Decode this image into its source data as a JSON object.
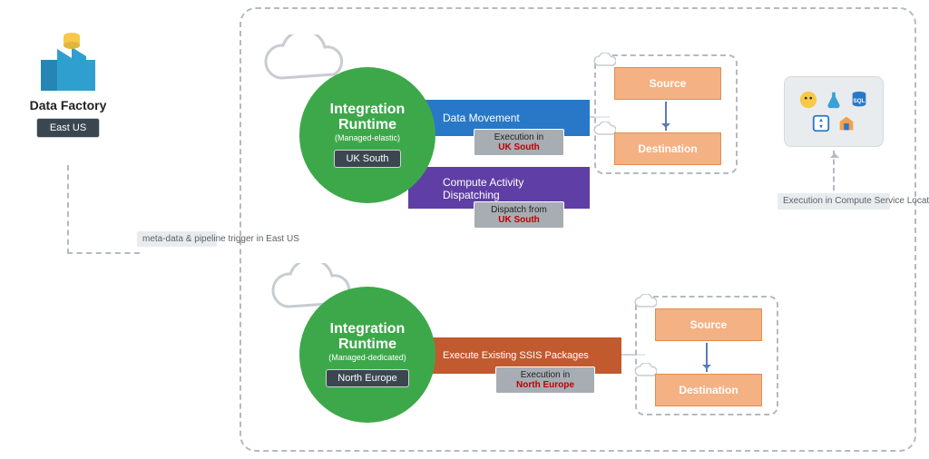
{
  "data_factory": {
    "title": "Data Factory",
    "region": "East US"
  },
  "meta_bubble": "meta-data & pipeline trigger in East US",
  "ir": [
    {
      "title": "Integration Runtime",
      "subtitle": "(Managed-elastic)",
      "region": "UK South"
    },
    {
      "title": "Integration Runtime",
      "subtitle": "(Managed-dedicated)",
      "region": "North Europe"
    }
  ],
  "activities": {
    "data_movement": "Data Movement",
    "compute_dispatch_l1": "Compute Activity",
    "compute_dispatch_l2": "Dispatching",
    "ssis": "Execute Existing SSIS Packages"
  },
  "under_badges": {
    "exec_uk_l1": "Execution in",
    "exec_uk_l2": "UK South",
    "disp_uk_l1": "Dispatch from",
    "disp_uk_l2": "UK South",
    "exec_ne_l1": "Execution in",
    "exec_ne_l2": "North Europe"
  },
  "sd": {
    "source": "Source",
    "destination": "Destination"
  },
  "compute_label": "Execution in Compute Service Location"
}
